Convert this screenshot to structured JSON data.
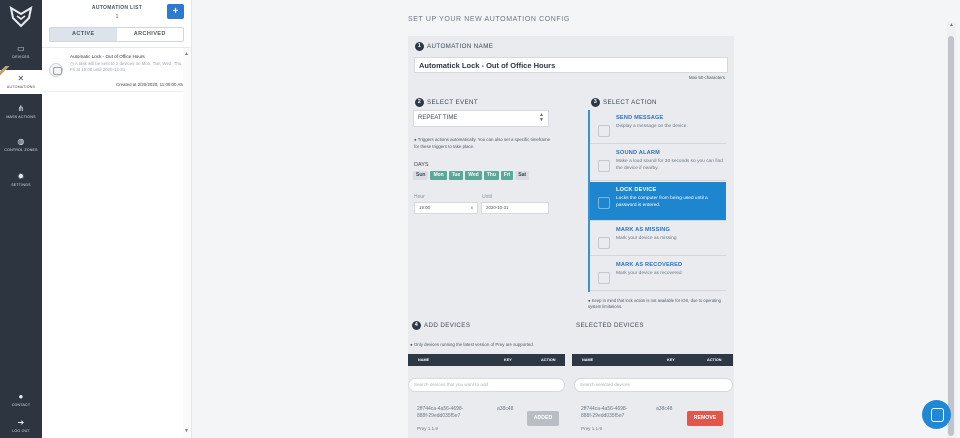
{
  "rail": {
    "items": [
      {
        "label": "DEVICES",
        "icon": "laptop-icon"
      },
      {
        "label": "AUTOMATIONS",
        "icon": "tools-icon"
      },
      {
        "label": "MASS ACTIONS",
        "icon": "sitemap-icon"
      },
      {
        "label": "CONTROL ZONES",
        "icon": "globe-icon"
      },
      {
        "label": "SETTINGS",
        "icon": "gear-icon"
      }
    ],
    "bottom": [
      {
        "label": "CONTACT",
        "icon": "contact-icon"
      },
      {
        "label": "LOG OUT",
        "icon": "logout-icon"
      }
    ],
    "active": "AUTOMATIONS",
    "bg_color": "#2c3540"
  },
  "list_panel": {
    "title": "AUTOMATION LIST",
    "count": "1",
    "add_label": "+",
    "tabs": [
      "ACTIVE",
      "ARCHIVED"
    ],
    "active_tab": "ACTIVE",
    "item": {
      "name": "Automatic Lock - Out of Office Hours",
      "desc": "A task will be sent to 2 devices on Mon, Tue, Wed, Thu, Fri at 19:00 until 2020-12-31",
      "created": "Created at 2/20/2020, 11:00:00 AM"
    }
  },
  "main": {
    "title": "SET UP YOUR NEW AUTOMATION CONFIG",
    "step1": {
      "num": "1",
      "label": "AUTOMATION NAME",
      "value": "Automatick Lock - Out of Office Hours",
      "max": "Max 50 characters"
    },
    "step2": {
      "num": "2",
      "label": "SELECT EVENT",
      "value": "REPEAT TIME",
      "hint": "Triggers actions automatically. You can also set a specific timeframe for these triggers to take place.",
      "days_label": "DAYS",
      "days": [
        "Sun",
        "Mon",
        "Tue",
        "Wed",
        "Thu",
        "Fri",
        "Sat"
      ],
      "days_active": [
        false,
        true,
        true,
        true,
        true,
        true,
        false
      ],
      "hour_label": "Hour",
      "hour_value": "19:00",
      "hour_clear": "x",
      "until_label": "Until",
      "until_value": "2020-10-31"
    },
    "step3": {
      "num": "3",
      "label": "SELECT ACTION",
      "actions": [
        {
          "title": "SEND MESSAGE",
          "desc": "Display a message on the device."
        },
        {
          "title": "SOUND ALARM",
          "desc": "Make a loud sound for 30 seconds so you can find the device if nearby."
        },
        {
          "title": "LOCK DEVICE",
          "desc": "Locks the computer from being used until a password is entered."
        },
        {
          "title": "MARK AS MISSING",
          "desc": "Mark your device as missing"
        },
        {
          "title": "MARK AS RECOVERED",
          "desc": "Mark your device as recovered"
        }
      ],
      "selected": "LOCK DEVICE",
      "note": "Keep in mind that lock action is not available for iOS, due to operating system limitations."
    },
    "step4": {
      "num": "4",
      "label": "ADD DEVICES",
      "selected_label": "SELECTED DEVICES",
      "note": "Only devices running the latest version of Prey are supported.",
      "columns": [
        "NAME",
        "KEY",
        "ACTION"
      ],
      "search_placeholder": "Search devices that you want to add",
      "selected_search_placeholder": "Search selected devices",
      "device": {
        "id_line1": "2ff744ca-4a56-4698-",
        "id_line2": "888f-29edd035f5e7",
        "key": "a38c48",
        "version": "Prey 1.1.9"
      },
      "added_label": "ADDED",
      "remove_label": "REMOVE"
    }
  },
  "colors": {
    "accent": "#1e85cf",
    "day_on": "#5aa897",
    "remove": "#e2574c",
    "chat": "#1f89d8"
  }
}
